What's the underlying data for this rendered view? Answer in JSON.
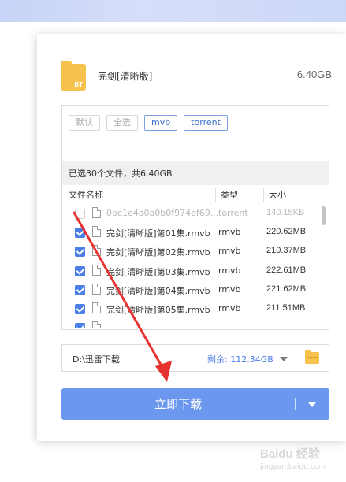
{
  "file": {
    "icon": "bt-file-icon",
    "icon_text": "BT",
    "title": "完剑[清晰版]",
    "total_size": "6.40GB"
  },
  "filters": [
    {
      "label": "默认",
      "active": false
    },
    {
      "label": "全选",
      "active": false
    },
    {
      "label": "mvb",
      "active": true
    },
    {
      "label": "torrent",
      "active": true
    }
  ],
  "selection_summary": "已选30个文件，共6.40GB",
  "columns": {
    "name": "文件名称",
    "type": "类型",
    "size": "大小"
  },
  "rows": [
    {
      "checked": false,
      "name": "0bc1e4a0a0b0f974ef69...",
      "type": "torrent",
      "size": "140.15KB"
    },
    {
      "checked": true,
      "name": "完剑[清晰版]第01集.rmvb",
      "type": "rmvb",
      "size": "220.62MB"
    },
    {
      "checked": true,
      "name": "完剑[清晰版]第02集.rmvb",
      "type": "rmvb",
      "size": "210.37MB"
    },
    {
      "checked": true,
      "name": "完剑[清晰版]第03集.rmvb",
      "type": "rmvb",
      "size": "222.61MB"
    },
    {
      "checked": true,
      "name": "完剑[清晰版]第04集.rmvb",
      "type": "rmvb",
      "size": "221.62MB"
    },
    {
      "checked": true,
      "name": "完剑[清晰版]第05集.rmvb",
      "type": "rmvb",
      "size": "211.51MB"
    },
    {
      "checked": true,
      "name": "",
      "type": "",
      "size": ""
    }
  ],
  "save_path": {
    "path": "D:\\迅雷下载",
    "free_space": "剩余: 112.34GB"
  },
  "download_button": {
    "label": "立即下载"
  },
  "watermark": {
    "text": "Baidu 经验",
    "sub": "jingyan.baidu.com"
  },
  "colors": {
    "accent": "#6b97ee",
    "annotation_arrow": "#e8322f",
    "folder": "#f6c24e"
  }
}
